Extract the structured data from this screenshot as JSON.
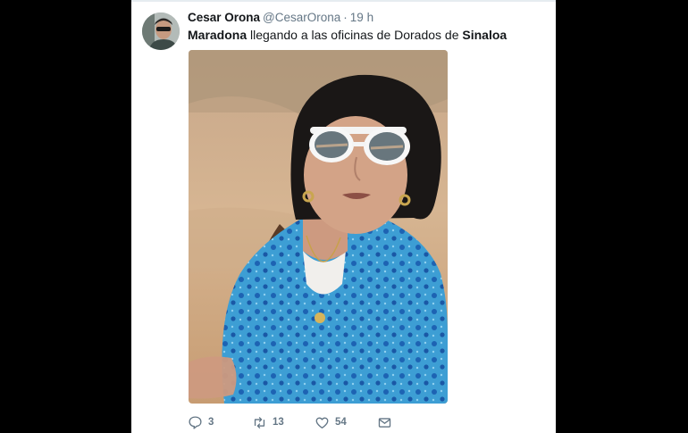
{
  "tweet": {
    "author_name": "Cesar Orona",
    "handle": "@CesarOrona",
    "separator": "·",
    "time": "19 h",
    "text_bold_1": "Maradona",
    "text_middle": " llegando a las oficinas de Dorados de ",
    "text_bold_2": "Sinaloa"
  },
  "actions": {
    "reply_count": "3",
    "retweet_count": "13",
    "like_count": "54"
  },
  "icons": [
    "reply-icon",
    "retweet-icon",
    "like-icon",
    "message-icon"
  ],
  "colors": {
    "secondary_text": "#657786",
    "primary_text": "#14171a",
    "shirt_blue": "#2f93c9"
  }
}
